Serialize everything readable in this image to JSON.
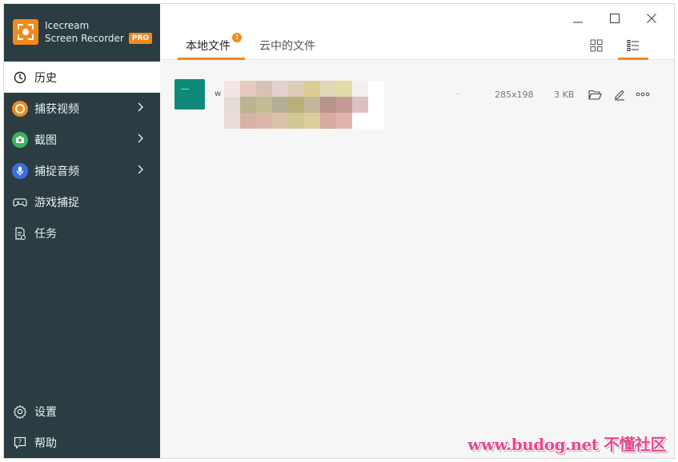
{
  "app": {
    "name_line1": "Icecream",
    "name_line2": "Screen Recorder",
    "pro_badge": "PRO"
  },
  "sidebar": {
    "items": [
      {
        "label": "历史",
        "icon": "clock-icon",
        "active": true
      },
      {
        "label": "捕获视频",
        "icon": "record-icon",
        "has_submenu": true
      },
      {
        "label": "截图",
        "icon": "camera-icon",
        "has_submenu": true
      },
      {
        "label": "捕捉音频",
        "icon": "microphone-icon",
        "has_submenu": true
      },
      {
        "label": "游戏捕捉",
        "icon": "gamepad-icon"
      },
      {
        "label": "任务",
        "icon": "task-icon"
      }
    ],
    "bottom_items": [
      {
        "label": "设置",
        "icon": "gear-icon"
      },
      {
        "label": "帮助",
        "icon": "help-icon"
      }
    ]
  },
  "tabs": [
    {
      "label": "本地文件",
      "active": true,
      "badge": "1"
    },
    {
      "label": "云中的文件",
      "active": false
    }
  ],
  "files": [
    {
      "name": "w",
      "dash": "-",
      "dimensions": "285x198",
      "size": "3 KB"
    }
  ],
  "watermark": "www.budog.net 不懂社区",
  "colors": {
    "accent": "#f08a1c",
    "sidebar_bg": "#2b3d42",
    "capture_video": "#f08a1c",
    "screenshot": "#3fb35a",
    "audio": "#3b6fe0",
    "thumb": "#0f8a78"
  }
}
